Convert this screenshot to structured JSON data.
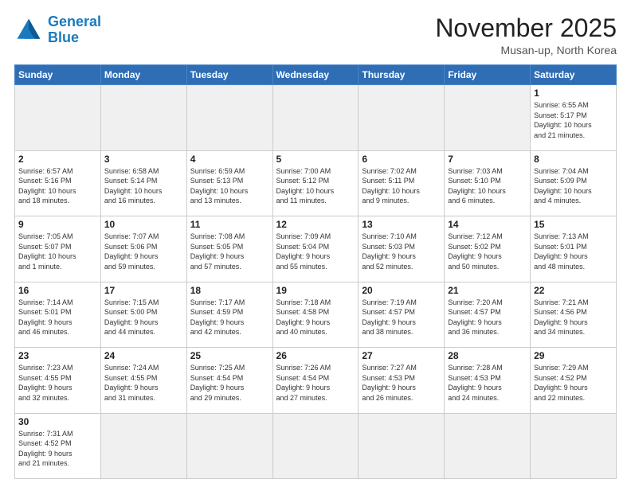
{
  "logo": {
    "line1": "General",
    "line2": "Blue"
  },
  "title": "November 2025",
  "subtitle": "Musan-up, North Korea",
  "header": {
    "days": [
      "Sunday",
      "Monday",
      "Tuesday",
      "Wednesday",
      "Thursday",
      "Friday",
      "Saturday"
    ]
  },
  "weeks": [
    [
      {
        "day": "",
        "info": ""
      },
      {
        "day": "",
        "info": ""
      },
      {
        "day": "",
        "info": ""
      },
      {
        "day": "",
        "info": ""
      },
      {
        "day": "",
        "info": ""
      },
      {
        "day": "",
        "info": ""
      },
      {
        "day": "1",
        "info": "Sunrise: 6:55 AM\nSunset: 5:17 PM\nDaylight: 10 hours\nand 21 minutes."
      }
    ],
    [
      {
        "day": "2",
        "info": "Sunrise: 6:57 AM\nSunset: 5:16 PM\nDaylight: 10 hours\nand 18 minutes."
      },
      {
        "day": "3",
        "info": "Sunrise: 6:58 AM\nSunset: 5:14 PM\nDaylight: 10 hours\nand 16 minutes."
      },
      {
        "day": "4",
        "info": "Sunrise: 6:59 AM\nSunset: 5:13 PM\nDaylight: 10 hours\nand 13 minutes."
      },
      {
        "day": "5",
        "info": "Sunrise: 7:00 AM\nSunset: 5:12 PM\nDaylight: 10 hours\nand 11 minutes."
      },
      {
        "day": "6",
        "info": "Sunrise: 7:02 AM\nSunset: 5:11 PM\nDaylight: 10 hours\nand 9 minutes."
      },
      {
        "day": "7",
        "info": "Sunrise: 7:03 AM\nSunset: 5:10 PM\nDaylight: 10 hours\nand 6 minutes."
      },
      {
        "day": "8",
        "info": "Sunrise: 7:04 AM\nSunset: 5:09 PM\nDaylight: 10 hours\nand 4 minutes."
      }
    ],
    [
      {
        "day": "9",
        "info": "Sunrise: 7:05 AM\nSunset: 5:07 PM\nDaylight: 10 hours\nand 1 minute."
      },
      {
        "day": "10",
        "info": "Sunrise: 7:07 AM\nSunset: 5:06 PM\nDaylight: 9 hours\nand 59 minutes."
      },
      {
        "day": "11",
        "info": "Sunrise: 7:08 AM\nSunset: 5:05 PM\nDaylight: 9 hours\nand 57 minutes."
      },
      {
        "day": "12",
        "info": "Sunrise: 7:09 AM\nSunset: 5:04 PM\nDaylight: 9 hours\nand 55 minutes."
      },
      {
        "day": "13",
        "info": "Sunrise: 7:10 AM\nSunset: 5:03 PM\nDaylight: 9 hours\nand 52 minutes."
      },
      {
        "day": "14",
        "info": "Sunrise: 7:12 AM\nSunset: 5:02 PM\nDaylight: 9 hours\nand 50 minutes."
      },
      {
        "day": "15",
        "info": "Sunrise: 7:13 AM\nSunset: 5:01 PM\nDaylight: 9 hours\nand 48 minutes."
      }
    ],
    [
      {
        "day": "16",
        "info": "Sunrise: 7:14 AM\nSunset: 5:01 PM\nDaylight: 9 hours\nand 46 minutes."
      },
      {
        "day": "17",
        "info": "Sunrise: 7:15 AM\nSunset: 5:00 PM\nDaylight: 9 hours\nand 44 minutes."
      },
      {
        "day": "18",
        "info": "Sunrise: 7:17 AM\nSunset: 4:59 PM\nDaylight: 9 hours\nand 42 minutes."
      },
      {
        "day": "19",
        "info": "Sunrise: 7:18 AM\nSunset: 4:58 PM\nDaylight: 9 hours\nand 40 minutes."
      },
      {
        "day": "20",
        "info": "Sunrise: 7:19 AM\nSunset: 4:57 PM\nDaylight: 9 hours\nand 38 minutes."
      },
      {
        "day": "21",
        "info": "Sunrise: 7:20 AM\nSunset: 4:57 PM\nDaylight: 9 hours\nand 36 minutes."
      },
      {
        "day": "22",
        "info": "Sunrise: 7:21 AM\nSunset: 4:56 PM\nDaylight: 9 hours\nand 34 minutes."
      }
    ],
    [
      {
        "day": "23",
        "info": "Sunrise: 7:23 AM\nSunset: 4:55 PM\nDaylight: 9 hours\nand 32 minutes."
      },
      {
        "day": "24",
        "info": "Sunrise: 7:24 AM\nSunset: 4:55 PM\nDaylight: 9 hours\nand 31 minutes."
      },
      {
        "day": "25",
        "info": "Sunrise: 7:25 AM\nSunset: 4:54 PM\nDaylight: 9 hours\nand 29 minutes."
      },
      {
        "day": "26",
        "info": "Sunrise: 7:26 AM\nSunset: 4:54 PM\nDaylight: 9 hours\nand 27 minutes."
      },
      {
        "day": "27",
        "info": "Sunrise: 7:27 AM\nSunset: 4:53 PM\nDaylight: 9 hours\nand 26 minutes."
      },
      {
        "day": "28",
        "info": "Sunrise: 7:28 AM\nSunset: 4:53 PM\nDaylight: 9 hours\nand 24 minutes."
      },
      {
        "day": "29",
        "info": "Sunrise: 7:29 AM\nSunset: 4:52 PM\nDaylight: 9 hours\nand 22 minutes."
      }
    ],
    [
      {
        "day": "30",
        "info": "Sunrise: 7:31 AM\nSunset: 4:52 PM\nDaylight: 9 hours\nand 21 minutes."
      },
      {
        "day": "",
        "info": ""
      },
      {
        "day": "",
        "info": ""
      },
      {
        "day": "",
        "info": ""
      },
      {
        "day": "",
        "info": ""
      },
      {
        "day": "",
        "info": ""
      },
      {
        "day": "",
        "info": ""
      }
    ]
  ]
}
